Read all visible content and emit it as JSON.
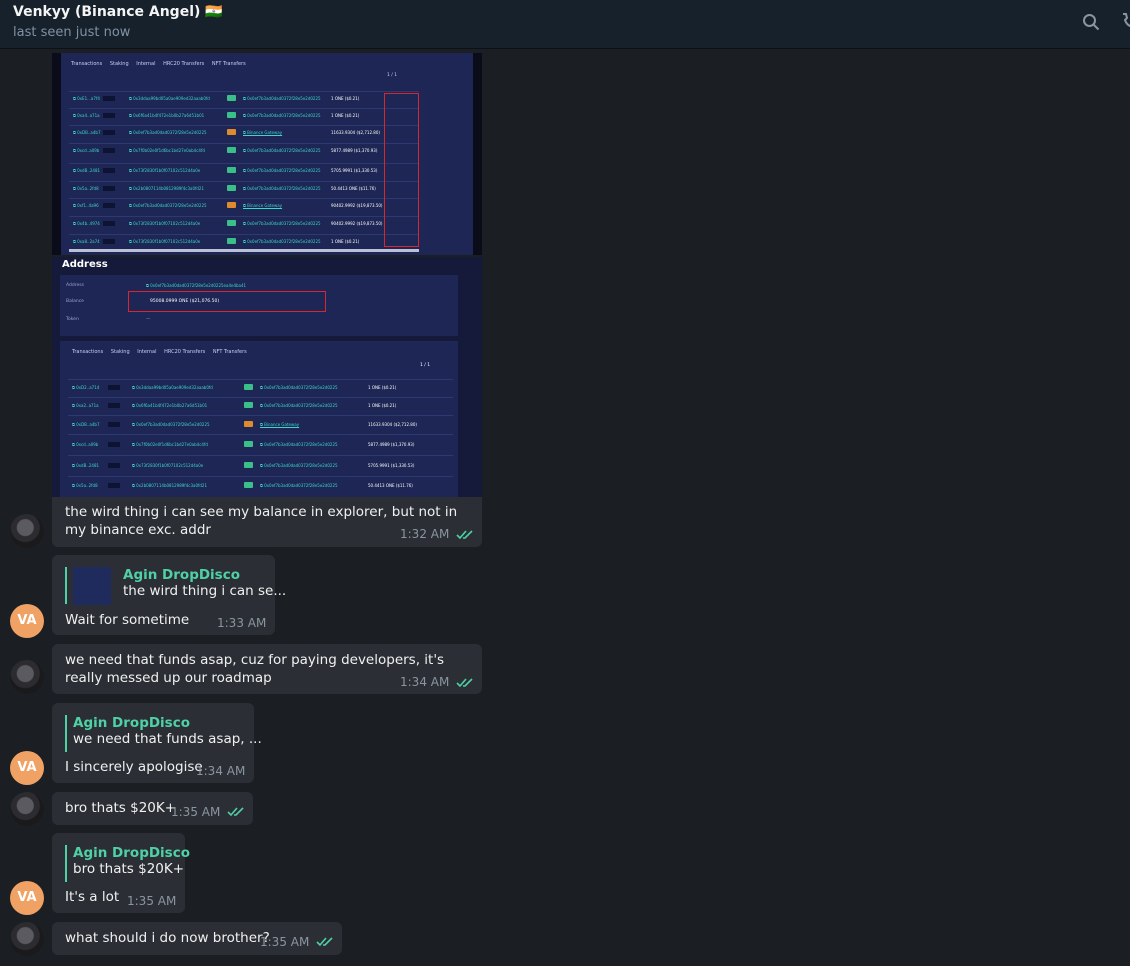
{
  "header": {
    "contact_name": "Venkyy (Binance Angel) 🇮🇳",
    "status": "last seen just now"
  },
  "image1": {
    "tabs": [
      "Transactions",
      "Staking",
      "Internal",
      "HRC20 Transfers",
      "NFT Transfers"
    ],
    "pager": "1 / 1"
  },
  "image2": {
    "heading": "Address",
    "balance_label": "Balance",
    "balance_value": "95008.0999 ONE ($21,076.50)",
    "address_label": "Address",
    "token_label": "Token",
    "tabs": [
      "Transactions",
      "Staking",
      "Internal",
      "HRC20 Transfers",
      "NFT Transfers"
    ],
    "pager": "1 / 1"
  },
  "messages": [
    {
      "text": "the wird thing i can see my balance in explorer, but not in my binance exc. addr",
      "time": "1:32 AM"
    },
    {
      "reply_name": "Agin DropDisco",
      "reply_text": "the wird thing i can se...",
      "text": "Wait for sometime",
      "time": "1:33 AM"
    },
    {
      "text": "we need that funds asap, cuz for paying developers, it's really messed up our roadmap",
      "time": "1:34 AM"
    },
    {
      "reply_name": "Agin DropDisco",
      "reply_text": "we need that funds asap, ...",
      "text": "I sincerely apologise",
      "time": "1:34 AM"
    },
    {
      "text": "bro thats $20K+",
      "time": "1:35 AM"
    },
    {
      "reply_name": "Agin DropDisco",
      "reply_text": "bro thats $20K+",
      "text": "It's a lot",
      "time": "1:35 AM"
    },
    {
      "text": "what should i do now brother?",
      "time": "1:35 AM"
    }
  ],
  "avatar_initials": "VA",
  "colors": {
    "accent": "#4fd1a5",
    "bubble": "#2b2f35",
    "background": "#1b1e22",
    "avatar": "#f0a265",
    "highlight": "#d8262d"
  }
}
